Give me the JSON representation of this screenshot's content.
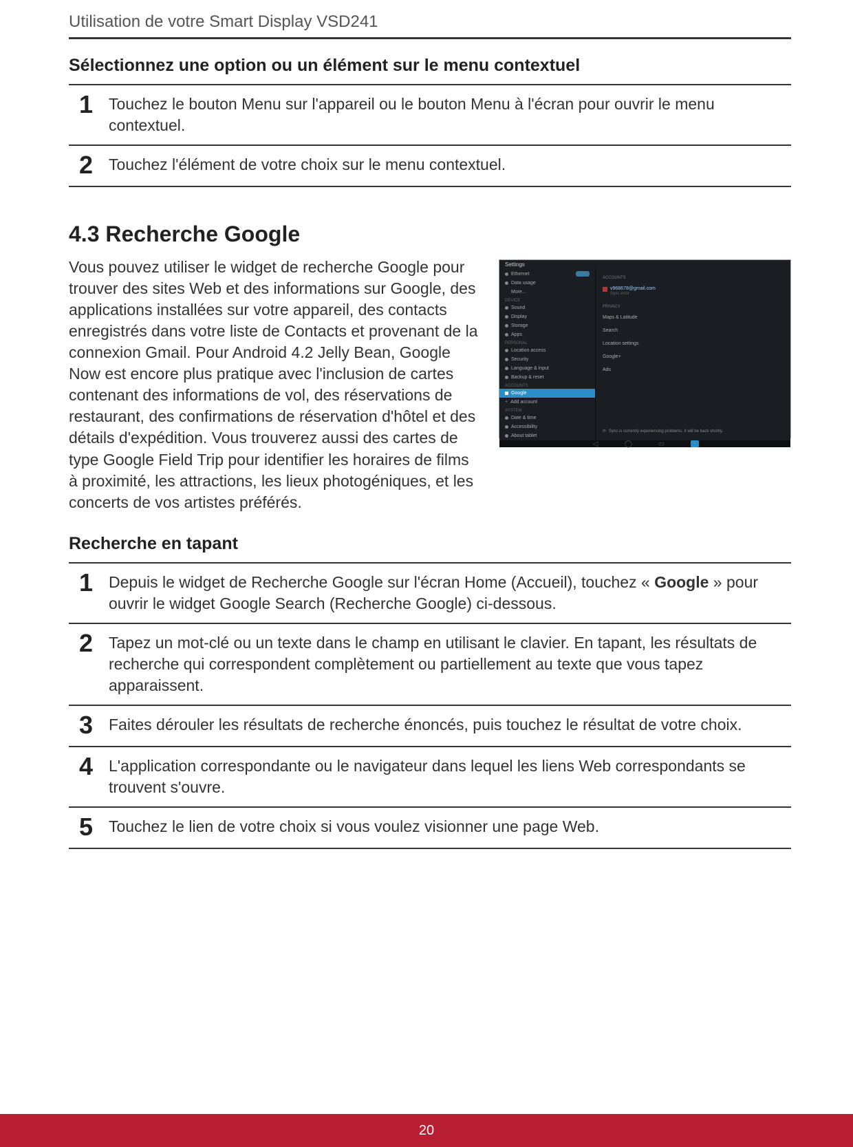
{
  "header": "Utilisation de votre Smart Display VSD241",
  "section1": {
    "title": "Sélectionnez une option ou un élément sur le menu contextuel",
    "steps": [
      {
        "n": "1",
        "text": "Touchez le bouton Menu sur l'appareil ou le bouton Menu à l'écran pour ouvrir le menu contextuel."
      },
      {
        "n": "2",
        "text": "Touchez l'élément de votre choix sur le menu contextuel."
      }
    ]
  },
  "section2": {
    "heading": "4.3  Recherche Google",
    "paragraph": "Vous pouvez utiliser le widget de recherche Google pour trouver des sites Web et des informations sur Google, des applications installées sur votre appareil, des contacts enregistrés dans votre liste de Contacts et provenant de la connexion Gmail. Pour Android 4.2 Jelly Bean, Google Now est encore plus pratique avec l'inclusion de cartes contenant des informations de vol, des réservations de restaurant, des confirmations de réservation d'hôtel et des détails d'expédition. Vous trouverez aussi des cartes de type Google Field Trip pour identifier les horaires de films à proximité, les attractions, les lieux photogéniques, et les concerts de vos artistes préférés."
  },
  "screenshot": {
    "titlebar": "Settings",
    "left_highlighted": "Google",
    "left_items_top": [
      "Ethernet",
      "Data usage",
      "More..."
    ],
    "left_cat1": "DEVICE",
    "left_items_device": [
      "Sound",
      "Display",
      "Storage",
      "Apps"
    ],
    "left_cat2": "PERSONAL",
    "left_items_personal": [
      "Location access",
      "Security",
      "Language & input",
      "Backup & reset"
    ],
    "left_cat3": "ACCOUNTS",
    "left_items_accounts": [
      "Google",
      "Add account"
    ],
    "left_cat4": "SYSTEM",
    "left_items_system": [
      "Date & time",
      "Accessibility",
      "About tablet"
    ],
    "right_cat_accounts": "ACCOUNTS",
    "right_email": "v968678@gmail.com",
    "right_sub": "Sync error",
    "right_cat_privacy": "PRIVACY",
    "right_items": [
      "Maps & Latitude",
      "Search",
      "Location settings",
      "Google+",
      "Ads"
    ],
    "sync_text": "Sync is currently experiencing problems. It will be back shortly."
  },
  "section3": {
    "title": "Recherche en tapant",
    "steps": [
      {
        "n": "1",
        "pre": "Depuis le widget de Recherche Google sur l'écran Home (Accueil), touchez « ",
        "bold": "Google",
        "post": " » pour ouvrir le widget Google Search (Recherche Google) ci-dessous."
      },
      {
        "n": "2",
        "text": "Tapez un mot-clé ou un texte dans le champ en utilisant le clavier. En tapant, les résultats de recherche qui correspondent complètement ou partiellement au texte que vous tapez apparaissent."
      },
      {
        "n": "3",
        "text": "Faites dérouler les résultats de recherche énoncés, puis touchez le résultat de votre choix."
      },
      {
        "n": "4",
        "text": "L'application correspondante ou le navigateur dans lequel les liens Web correspondants se trouvent s'ouvre."
      },
      {
        "n": "5",
        "text": "Touchez le lien de votre choix si vous voulez visionner une page Web."
      }
    ]
  },
  "page_number": "20"
}
